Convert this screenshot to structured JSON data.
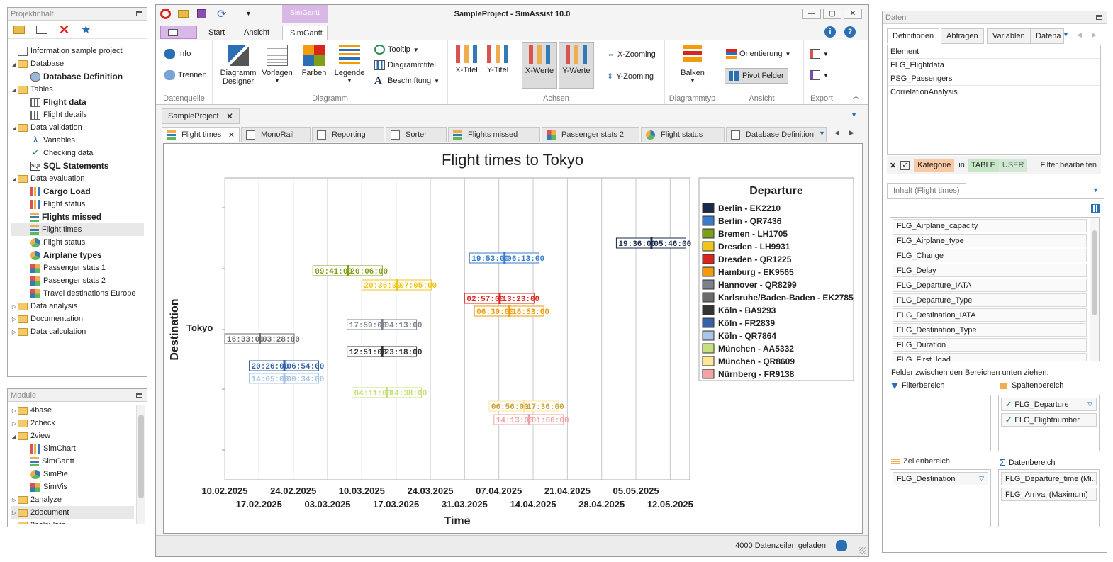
{
  "project_panel": {
    "title": "Projektinhalt",
    "tree": [
      {
        "label": "Information sample project",
        "icon": "doc-icon",
        "level": 0,
        "bold": false
      },
      {
        "label": "Database",
        "icon": "folder-icon",
        "level": 0,
        "bold": false,
        "expanded": true
      },
      {
        "label": "Database Definition",
        "icon": "database-icon",
        "level": 1,
        "bold": true
      },
      {
        "label": "Tables",
        "icon": "folder-icon",
        "level": 0,
        "expanded": true
      },
      {
        "label": "Flight data",
        "icon": "table-icon",
        "level": 1,
        "bold": true
      },
      {
        "label": "Flight details",
        "icon": "table-icon",
        "level": 1,
        "bold": false
      },
      {
        "label": "Data validation",
        "icon": "folder-icon",
        "level": 0,
        "expanded": true
      },
      {
        "label": "Variables",
        "icon": "variable-icon",
        "level": 1,
        "bold": false
      },
      {
        "label": "Checking data",
        "icon": "check-icon",
        "level": 1,
        "bold": false
      },
      {
        "label": "SQL Statements",
        "icon": "sql-icon",
        "level": 1,
        "bold": true
      },
      {
        "label": "Data evaluation",
        "icon": "folder-icon",
        "level": 0,
        "expanded": true
      },
      {
        "label": "Cargo Load",
        "icon": "bar-chart-icon",
        "level": 1,
        "bold": true
      },
      {
        "label": "Flight status",
        "icon": "bar-chart-icon",
        "level": 1,
        "bold": false
      },
      {
        "label": "Flights missed",
        "icon": "gantt-icon",
        "level": 1,
        "bold": true
      },
      {
        "label": "Flight times",
        "icon": "gantt-icon",
        "level": 1,
        "bold": false,
        "selected": true
      },
      {
        "label": "Flight status",
        "icon": "pie-chart-icon",
        "level": 1,
        "bold": false
      },
      {
        "label": "Airplane types",
        "icon": "pie-chart-icon",
        "level": 1,
        "bold": true
      },
      {
        "label": "Passenger stats 1",
        "icon": "heatmap-icon",
        "level": 1,
        "bold": false
      },
      {
        "label": "Passenger stats 2",
        "icon": "heatmap-icon",
        "level": 1,
        "bold": false
      },
      {
        "label": "Travel destinations Europe",
        "icon": "heatmap-icon",
        "level": 1,
        "bold": false
      },
      {
        "label": "Data analysis",
        "icon": "folder-icon",
        "level": 0,
        "expanded": false
      },
      {
        "label": "Documentation",
        "icon": "folder-icon",
        "level": 0,
        "expanded": false
      },
      {
        "label": "Data calculation",
        "icon": "folder-icon",
        "level": 0,
        "expanded": false
      }
    ]
  },
  "module_panel": {
    "title": "Module",
    "tree": [
      {
        "label": "4base",
        "icon": "folder-icon",
        "level": 0,
        "expanded": false
      },
      {
        "label": "2check",
        "icon": "folder-icon",
        "level": 0,
        "expanded": false
      },
      {
        "label": "2view",
        "icon": "folder-icon",
        "level": 0,
        "expanded": true
      },
      {
        "label": "SimChart",
        "icon": "bar-chart-icon",
        "level": 1
      },
      {
        "label": "SimGantt",
        "icon": "gantt-icon",
        "level": 1
      },
      {
        "label": "SimPie",
        "icon": "pie-chart-icon",
        "level": 1
      },
      {
        "label": "SimVis",
        "icon": "heatmap-icon",
        "level": 1
      },
      {
        "label": "2analyze",
        "icon": "folder-icon",
        "level": 0,
        "expanded": false
      },
      {
        "label": "2document",
        "icon": "folder-icon",
        "level": 0,
        "expanded": false,
        "selected": true
      },
      {
        "label": "2calculate",
        "icon": "folder-icon",
        "level": 0,
        "expanded": false
      }
    ]
  },
  "window": {
    "title": "SampleProject - SimAssist 10.0",
    "context_tab": "SimGantt",
    "tabs": [
      "Start",
      "Ansicht",
      "SimGantt"
    ],
    "active_tab": "SimGantt"
  },
  "ribbon": {
    "datenquelle": {
      "label": "Datenquelle",
      "info": "Info",
      "trennen": "Trennen"
    },
    "diagramm": {
      "label": "Diagramm",
      "designer": "Diagramm Designer",
      "vorlagen": "Vorlagen",
      "farben": "Farben",
      "legende": "Legende",
      "tooltip": "Tooltip",
      "diagrammtitel": "Diagrammtitel",
      "beschriftung": "Beschriftung"
    },
    "achsen": {
      "label": "Achsen",
      "xtitel": "X-Titel",
      "ytitel": "Y-Titel",
      "xwerte": "X-Werte",
      "ywerte": "Y-Werte",
      "xzoom": "X-Zooming",
      "yzoom": "Y-Zooming"
    },
    "diagrammtyp": {
      "label": "Diagrammtyp",
      "balken": "Balken"
    },
    "ansicht": {
      "label": "Ansicht",
      "orientierung": "Orientierung",
      "pivot": "Pivot Felder"
    },
    "export": {
      "label": "Export"
    }
  },
  "doc_tab": "SampleProject",
  "sub_tabs": [
    {
      "label": "Flight times",
      "icon": "gantt-icon",
      "active": true
    },
    {
      "label": "MonoRail",
      "icon": "monorail-icon"
    },
    {
      "label": "Reporting",
      "icon": "report-icon"
    },
    {
      "label": "Sorter",
      "icon": "sorter-icon"
    },
    {
      "label": "Flights missed",
      "icon": "gantt-icon"
    },
    {
      "label": "Passenger stats 2",
      "icon": "heatmap-icon"
    },
    {
      "label": "Flight status",
      "icon": "pie-chart-icon"
    },
    {
      "label": "Database Definition",
      "icon": "database-icon"
    }
  ],
  "chart_data": {
    "type": "gantt",
    "title": "Flight times to Tokyo",
    "xlabel": "Time",
    "ylabel": "Destination",
    "y_category": "Tokyo",
    "x_ticks_top": [
      "10.02.2025",
      "24.02.2025",
      "10.03.2025",
      "24.03.2025",
      "07.04.2025",
      "21.04.2025",
      "05.05.2025"
    ],
    "x_ticks_bottom": [
      "17.02.2025",
      "03.03.2025",
      "17.03.2025",
      "31.03.2025",
      "14.04.2025",
      "28.04.2025",
      "12.05.2025"
    ],
    "xlim": [
      "2025-02-10",
      "2025-05-16"
    ],
    "legend_title": "Departure",
    "legend_position": "right",
    "series": [
      {
        "name": "Berlin - EK2210",
        "color": "#1b2a4a",
        "start": "2025-05-01",
        "start_label": "19:36:00",
        "end_label": "05:46:00"
      },
      {
        "name": "Berlin - QR7436",
        "color": "#3a7cc9",
        "start": "2025-04-01",
        "start_label": "19:53:00",
        "end_label": "06:13:00"
      },
      {
        "name": "Bremen - LH1705",
        "color": "#7f9f1a",
        "start": "2025-02-28",
        "start_label": "09:41:00",
        "end_label": "20:06:00"
      },
      {
        "name": "Dresden - LH9931",
        "color": "#f0c419",
        "start": "2025-03-10",
        "start_label": "20:36:00",
        "end_label": "07:05:00"
      },
      {
        "name": "Dresden - QR1225",
        "color": "#d9251d",
        "start": "2025-03-31",
        "start_label": "02:57:00",
        "end_label": "13:23:00"
      },
      {
        "name": "Hamburg - EK9565",
        "color": "#f29b0c",
        "start": "2025-04-02",
        "start_label": "06:30:00",
        "end_label": "16:53:00"
      },
      {
        "name": "Hannover - QR8299",
        "color": "#7a838c",
        "start": "2025-03-07",
        "start_label": "17:59:00",
        "end_label": "04:13:00"
      },
      {
        "name": "Karlsruhe/Baden-Baden - EK2785",
        "color": "#6b6b6b",
        "start": "2025-02-10",
        "start_label": "16:33:00",
        "end_label": "03:28:00"
      },
      {
        "name": "Köln - BA9293",
        "color": "#333333",
        "start": "2025-03-07",
        "start_label": "12:51:00",
        "end_label": "23:18:00"
      },
      {
        "name": "Köln - FR2839",
        "color": "#3362a8",
        "start": "2025-02-15",
        "start_label": "20:26:00",
        "end_label": "06:54:00"
      },
      {
        "name": "Köln - QR7864",
        "color": "#a9c6e6",
        "start": "2025-02-15",
        "start_label": "14:05:00",
        "end_label": "00:34:00"
      },
      {
        "name": "München - AA5332",
        "color": "#c6e07a",
        "start": "2025-03-08",
        "start_label": "04:11:00",
        "end_label": "14:38:00"
      },
      {
        "name": "München - QR8609",
        "color": "#fbe69a",
        "start": "2025-04-05",
        "start_label": "06:56:00",
        "end_label": "17:36:00"
      },
      {
        "name": "Nürnberg - FR9138",
        "color": "#f2a2a2",
        "start": "2025-04-06",
        "start_label": "14:13:00",
        "end_label": "01:00:00"
      }
    ]
  },
  "status": {
    "text": "4000 Datenzeilen geladen"
  },
  "data_panel": {
    "title": "Daten",
    "tabs": [
      "Definitionen",
      "Abfragen",
      "Variablen",
      "Datena"
    ],
    "element_header": "Element",
    "elements": [
      "FLG_Flightdata",
      "PSG_Passengers",
      "CorrelationAnalysis"
    ],
    "filter": {
      "kategorie": "Kategorie",
      "in": "in",
      "table": "TABLE",
      "user": "USER",
      "edit": "Filter bearbeiten"
    },
    "content_tab": "Inhalt (Flight times)",
    "fields": [
      "FLG_Airplane_capacity",
      "FLG_Airplane_type",
      "FLG_Change",
      "FLG_Delay",
      "FLG_Departure_IATA",
      "FLG_Departure_Type",
      "FLG_Destination_IATA",
      "FLG_Destination_Type",
      "FLG_Duration",
      "FLG_First_load"
    ],
    "drag_hint": "Felder zwischen den Bereichen unten ziehen:",
    "filter_area": "Filterbereich",
    "column_area": "Spaltenbereich",
    "column_items": [
      "FLG_Departure",
      "FLG_Flightnumber"
    ],
    "row_area": "Zeilenbereich",
    "row_items": [
      "FLG_Destination"
    ],
    "data_area": "Datenbereich",
    "data_items": [
      "FLG_Departure_time (Mi...",
      "FLG_Arrival (Maximum)"
    ]
  }
}
